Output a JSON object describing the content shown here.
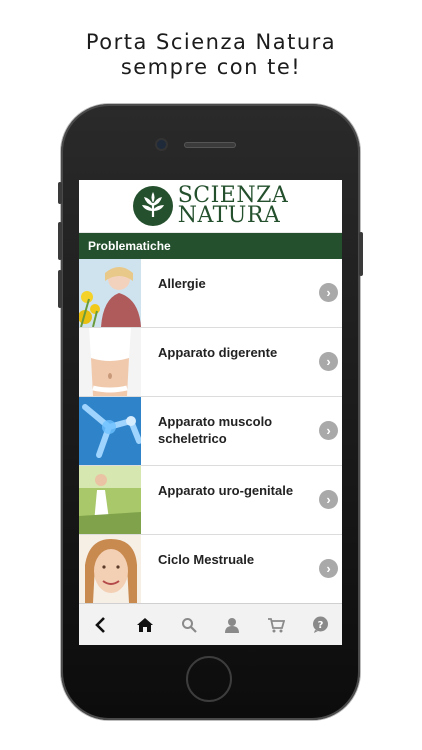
{
  "headline": {
    "line1": "Porta Scienza Natura",
    "line2": "sempre con te!"
  },
  "app": {
    "logo": {
      "line1": "SCIENZA",
      "line2": "NATURA"
    },
    "section_title": "Problematiche",
    "items": [
      {
        "label": "Allergie",
        "thumb": "woman-sneezing-flowers"
      },
      {
        "label": "Apparato digerente",
        "thumb": "woman-abdomen"
      },
      {
        "label": "Apparato muscolo scheletrico",
        "thumb": "xray-runner-skeleton"
      },
      {
        "label": "Apparato uro-genitale",
        "thumb": "woman-white-dress-meadow"
      },
      {
        "label": "Ciclo Mestruale",
        "thumb": "smiling-woman-portrait"
      }
    ],
    "tabbar": [
      "back-icon",
      "home-icon",
      "search-icon",
      "user-icon",
      "cart-icon",
      "help-icon"
    ]
  },
  "colors": {
    "brand_green": "#24502d",
    "chevron_gray": "#a9a9a9",
    "tabbar_bg": "#f2f2f2"
  }
}
